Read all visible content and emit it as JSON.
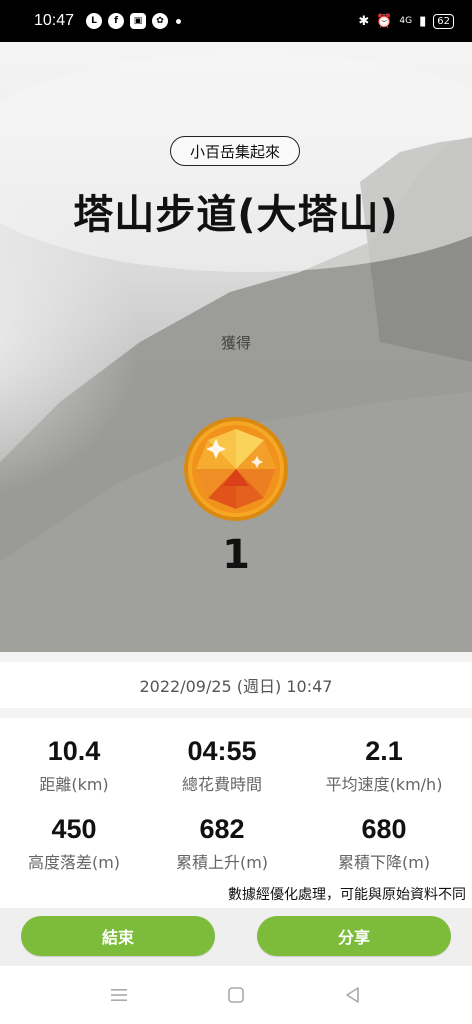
{
  "status_bar": {
    "time": "10:47",
    "left_icons": [
      "line-icon",
      "facebook-icon",
      "app-icon",
      "fan-icon"
    ],
    "network": "4G",
    "battery": "62"
  },
  "hero": {
    "collection_tag": "小百岳集起來",
    "title": "塔山步道(大塔山)",
    "obtain_label": "獲得",
    "medal_count": "1",
    "medal_icon": "gold-gem-medal-icon"
  },
  "record": {
    "datetime": "2022/09/25 (週日) 10:47"
  },
  "stats": [
    {
      "value": "10.4",
      "label": "距離(km)"
    },
    {
      "value": "04:55",
      "label": "總花費時間"
    },
    {
      "value": "2.1",
      "label": "平均速度(km/h)"
    },
    {
      "value": "450",
      "label": "高度落差(m)"
    },
    {
      "value": "682",
      "label": "累積上升(m)"
    },
    {
      "value": "680",
      "label": "累積下降(m)"
    }
  ],
  "disclaimer": "數據經優化處理，可能與原始資料不同",
  "actions": {
    "end_label": "結束",
    "share_label": "分享"
  },
  "colors": {
    "accent": "#7cbc3a",
    "medal_gold": "#f5a623"
  }
}
